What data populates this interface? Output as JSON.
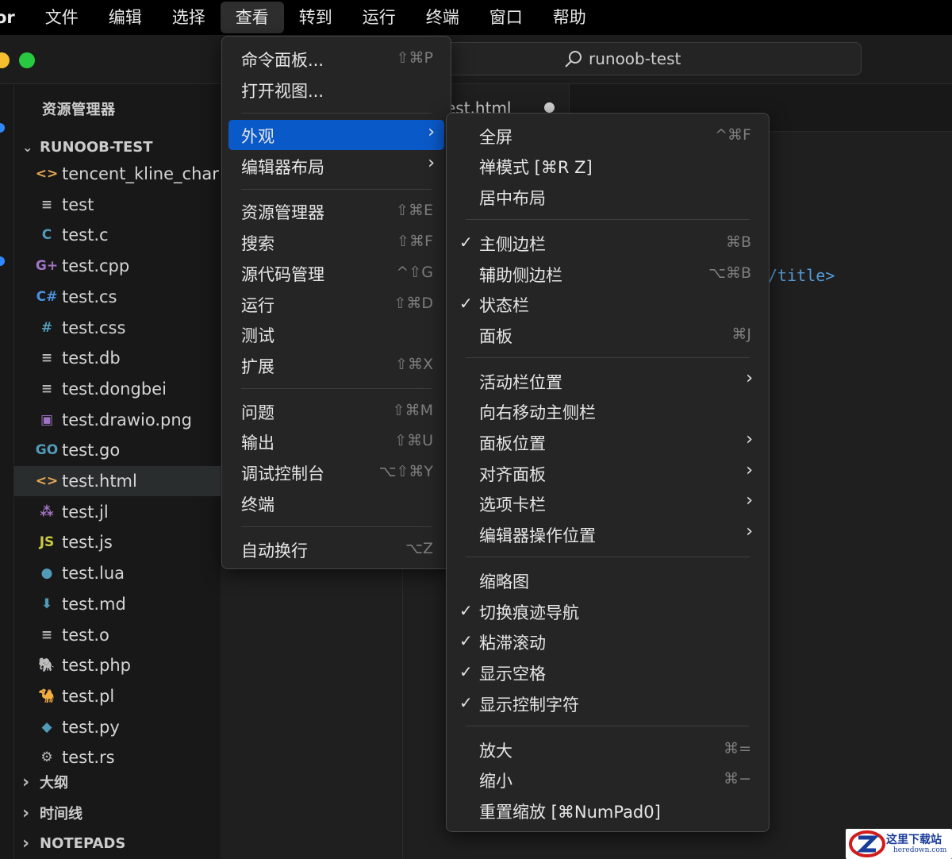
{
  "menubar": {
    "items": [
      "or",
      "文件",
      "编辑",
      "选择",
      "查看",
      "转到",
      "运行",
      "终端",
      "窗口",
      "帮助"
    ],
    "active_index": 4
  },
  "titlebar": {
    "search_label": "runoob-test",
    "traffic_colors": [
      "#f6bf2d",
      "#28c840"
    ]
  },
  "sidebar": {
    "title": "资源管理器",
    "folder": "RUNOOB-TEST",
    "files": [
      {
        "name": "tencent_kline_char",
        "icon": "<>",
        "icon_color": "#e8ab53",
        "icon_name": "html-icon"
      },
      {
        "name": "test",
        "icon": "≡",
        "icon_color": "#b8b8b8",
        "icon_name": "text-file-icon"
      },
      {
        "name": "test.c",
        "icon": "C",
        "icon_color": "#519aba",
        "icon_name": "c-icon"
      },
      {
        "name": "test.cpp",
        "icon": "G+",
        "icon_color": "#a074c4",
        "icon_name": "cpp-icon"
      },
      {
        "name": "test.cs",
        "icon": "C#",
        "icon_color": "#4a90e2",
        "icon_name": "csharp-icon"
      },
      {
        "name": "test.css",
        "icon": "#",
        "icon_color": "#519aba",
        "icon_name": "css-icon"
      },
      {
        "name": "test.db",
        "icon": "≡",
        "icon_color": "#b8b8b8",
        "icon_name": "text-file-icon"
      },
      {
        "name": "test.dongbei",
        "icon": "≡",
        "icon_color": "#b8b8b8",
        "icon_name": "text-file-icon"
      },
      {
        "name": "test.drawio.png",
        "icon": "▣",
        "icon_color": "#a074c4",
        "icon_name": "image-icon"
      },
      {
        "name": "test.go",
        "icon": "GO",
        "icon_color": "#519aba",
        "icon_name": "go-icon"
      },
      {
        "name": "test.html",
        "icon": "<>",
        "icon_color": "#e8ab53",
        "icon_name": "html-icon"
      },
      {
        "name": "test.jl",
        "icon": "⁂",
        "icon_color": "#a074c4",
        "icon_name": "julia-icon"
      },
      {
        "name": "test.js",
        "icon": "JS",
        "icon_color": "#cbcb41",
        "icon_name": "javascript-icon"
      },
      {
        "name": "test.lua",
        "icon": "●",
        "icon_color": "#519aba",
        "icon_name": "lua-icon"
      },
      {
        "name": "test.md",
        "icon": "⬇",
        "icon_color": "#519aba",
        "icon_name": "markdown-icon"
      },
      {
        "name": "test.o",
        "icon": "≡",
        "icon_color": "#b8b8b8",
        "icon_name": "text-file-icon"
      },
      {
        "name": "test.php",
        "icon": "🐘",
        "icon_color": "#a074c4",
        "icon_name": "php-icon"
      },
      {
        "name": "test.pl",
        "icon": "🐪",
        "icon_color": "#519aba",
        "icon_name": "perl-icon"
      },
      {
        "name": "test.py",
        "icon": "◆",
        "icon_color": "#519aba",
        "icon_name": "python-icon"
      },
      {
        "name": "test.rs",
        "icon": "⚙",
        "icon_color": "#b8b8b8",
        "icon_name": "rust-icon"
      }
    ],
    "selected_index": 10,
    "sections": [
      "大纲",
      "时间线",
      "NOTEPADS"
    ]
  },
  "editor": {
    "tab_label": "est.html",
    "code_fragment": "/title>"
  },
  "view_menu": {
    "items": [
      {
        "label": "命令面板...",
        "shortcut": "⇧⌘P"
      },
      {
        "label": "打开视图...",
        "shortcut": ""
      },
      {
        "label": "外观",
        "shortcut": "",
        "submenu": true,
        "highlighted": true
      },
      {
        "label": "编辑器布局",
        "shortcut": "",
        "submenu": true
      },
      {
        "label": "资源管理器",
        "shortcut": "⇧⌘E"
      },
      {
        "label": "搜索",
        "shortcut": "⇧⌘F"
      },
      {
        "label": "源代码管理",
        "shortcut": "^⇧G"
      },
      {
        "label": "运行",
        "shortcut": "⇧⌘D"
      },
      {
        "label": "测试",
        "shortcut": ""
      },
      {
        "label": "扩展",
        "shortcut": "⇧⌘X"
      },
      {
        "label": "问题",
        "shortcut": "⇧⌘M"
      },
      {
        "label": "输出",
        "shortcut": "⇧⌘U"
      },
      {
        "label": "调试控制台",
        "shortcut": "⌥⇧⌘Y"
      },
      {
        "label": "终端",
        "shortcut": ""
      },
      {
        "label": "自动换行",
        "shortcut": "⌥Z"
      }
    ]
  },
  "appearance_menu": {
    "items": [
      {
        "label": "全屏",
        "shortcut": "^⌘F",
        "checked": false
      },
      {
        "label": "禅模式 [⌘R Z]",
        "shortcut": "",
        "checked": false
      },
      {
        "label": "居中布局",
        "shortcut": "",
        "checked": false
      },
      {
        "label": "主侧边栏",
        "shortcut": "⌘B",
        "checked": true
      },
      {
        "label": "辅助侧边栏",
        "shortcut": "⌥⌘B",
        "checked": false
      },
      {
        "label": "状态栏",
        "shortcut": "",
        "checked": true
      },
      {
        "label": "面板",
        "shortcut": "⌘J",
        "checked": false
      },
      {
        "label": "活动栏位置",
        "shortcut": "",
        "checked": false,
        "submenu": true
      },
      {
        "label": "向右移动主侧栏",
        "shortcut": "",
        "checked": false
      },
      {
        "label": "面板位置",
        "shortcut": "",
        "checked": false,
        "submenu": true
      },
      {
        "label": "对齐面板",
        "shortcut": "",
        "checked": false,
        "submenu": true
      },
      {
        "label": "选项卡栏",
        "shortcut": "",
        "checked": false,
        "submenu": true
      },
      {
        "label": "编辑器操作位置",
        "shortcut": "",
        "checked": false,
        "submenu": true
      },
      {
        "label": "缩略图",
        "shortcut": "",
        "checked": false
      },
      {
        "label": "切换痕迹导航",
        "shortcut": "",
        "checked": true
      },
      {
        "label": "粘滞滚动",
        "shortcut": "",
        "checked": true
      },
      {
        "label": "显示空格",
        "shortcut": "",
        "checked": true
      },
      {
        "label": "显示控制字符",
        "shortcut": "",
        "checked": true
      },
      {
        "label": "放大",
        "shortcut": "⌘=",
        "checked": false
      },
      {
        "label": "缩小",
        "shortcut": "⌘−",
        "checked": false
      },
      {
        "label": "重置缩放 [⌘NumPad0]",
        "shortcut": "",
        "checked": false
      }
    ]
  },
  "watermark": {
    "cn": "这里下载站",
    "en": "heredown.com"
  }
}
